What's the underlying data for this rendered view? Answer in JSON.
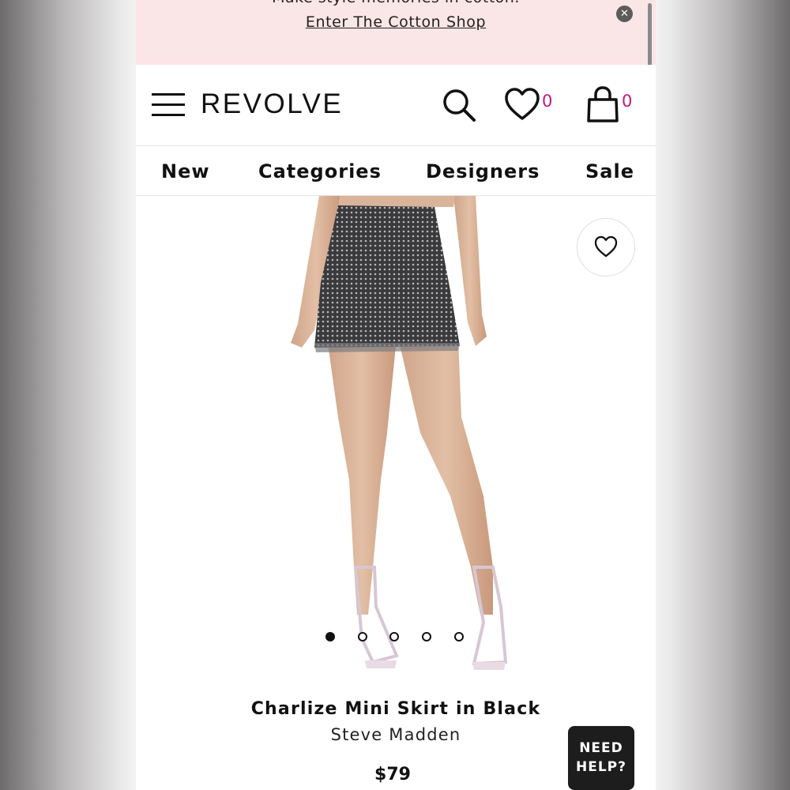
{
  "promo": {
    "text": "Make style memories in cotton.",
    "link": "Enter The Cotton Shop",
    "close_icon": "close-icon"
  },
  "header": {
    "logo": "REVOLVE",
    "wishlist_count": "0",
    "bag_count": "0",
    "icons": [
      "menu-icon",
      "search-icon",
      "heart-icon",
      "bag-icon"
    ]
  },
  "nav": {
    "items": [
      "New",
      "Categories",
      "Designers",
      "Sale"
    ]
  },
  "carousel": {
    "total": 5,
    "active": 1
  },
  "product": {
    "title": "Charlize Mini Skirt in Black",
    "brand": "Steve Madden",
    "price": "$79"
  },
  "help": {
    "line1": "NEED",
    "line2": "HELP?"
  },
  "colors": {
    "promo_bg": "#fbe6e7",
    "count_accent": "#c2187a",
    "help_bg": "#1d1d1d"
  }
}
